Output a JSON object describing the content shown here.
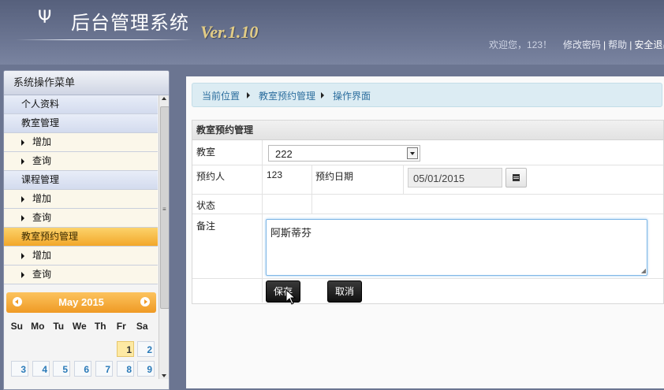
{
  "header": {
    "logo_glyph": "Ψ",
    "title": "后台管理系统",
    "version": "Ver.1.10",
    "welcome": "欢迎您，123！",
    "links": [
      "修改密码",
      "帮助",
      "安全退出"
    ],
    "separator": "|"
  },
  "sidebar": {
    "title": "系统操作菜单",
    "items": [
      {
        "label": "个人资料",
        "type": "head"
      },
      {
        "label": "教室管理",
        "type": "head"
      },
      {
        "label": "增加",
        "type": "sub"
      },
      {
        "label": "查询",
        "type": "sub"
      },
      {
        "label": "课程管理",
        "type": "head"
      },
      {
        "label": "增加",
        "type": "sub"
      },
      {
        "label": "查询",
        "type": "sub"
      },
      {
        "label": "教室预约管理",
        "type": "active"
      },
      {
        "label": "增加",
        "type": "sub"
      },
      {
        "label": "查询",
        "type": "sub"
      }
    ]
  },
  "calendar": {
    "title": "May 2015",
    "weekdays": [
      "Su",
      "Mo",
      "Tu",
      "We",
      "Th",
      "Fr",
      "Sa"
    ],
    "days_row1": [
      "1",
      "2"
    ],
    "days_row2": [
      "3",
      "4",
      "5",
      "6",
      "7",
      "8",
      "9"
    ],
    "today": "1"
  },
  "breadcrumb": {
    "items": [
      "当前位置",
      "教室预约管理",
      "操作界面"
    ]
  },
  "form": {
    "title": "教室预约管理",
    "classroom_label": "教室",
    "classroom_value": "222",
    "booker_label": "预约人",
    "booker_value": "123",
    "date_label": "预约日期",
    "date_value": "05/01/2015",
    "status_label": "状态",
    "remark_label": "备注",
    "remark_value": "阿斯蒂芬",
    "save_label": "保存",
    "cancel_label": "取消"
  },
  "colors": {
    "header_bg": "#6e7895",
    "menu_active": "#f2a72a",
    "breadcrumb_bg": "#dcecf3",
    "version": "#e2cc86"
  }
}
